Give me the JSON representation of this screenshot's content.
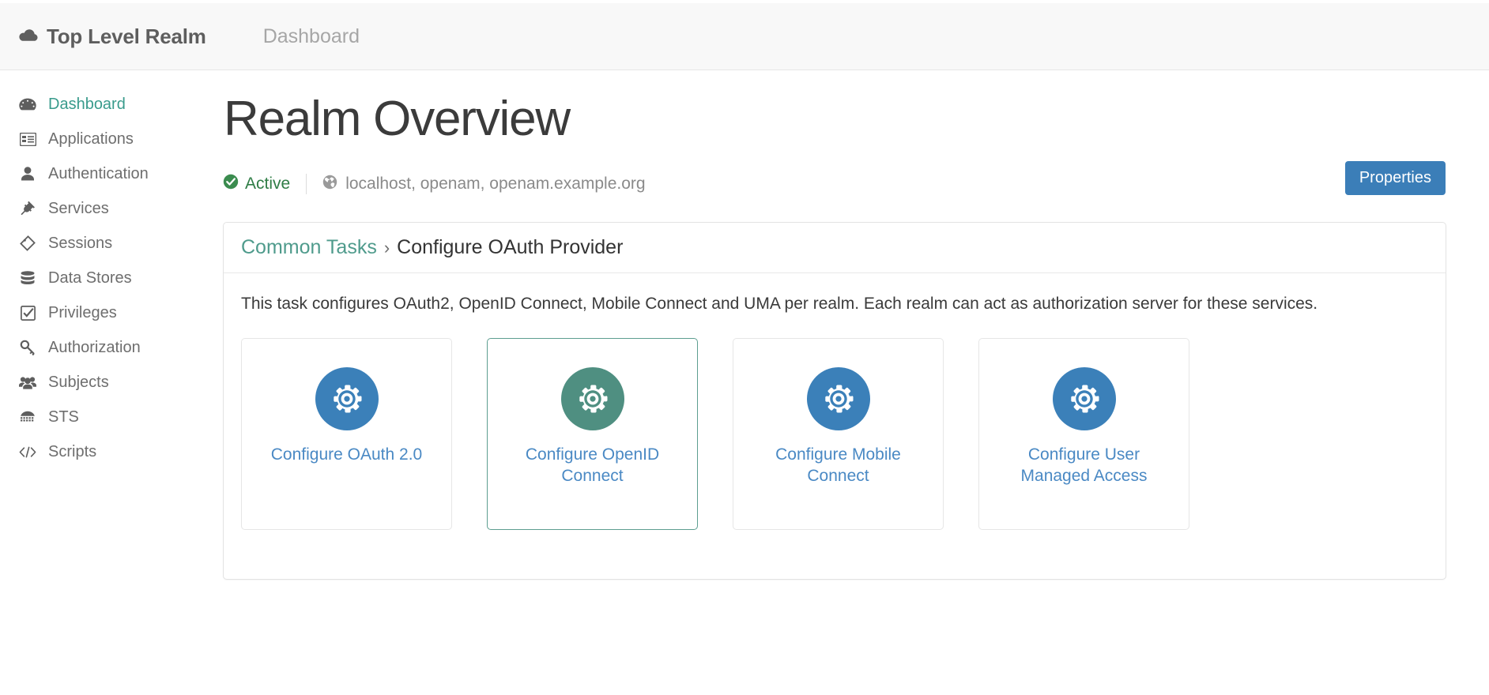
{
  "header": {
    "realm_icon": "cloud-icon",
    "realm_name": "Top Level Realm",
    "nav_item": "Dashboard"
  },
  "sidebar": {
    "items": [
      {
        "label": "Dashboard",
        "icon": "dashboard-gauge-icon",
        "active": true
      },
      {
        "label": "Applications",
        "icon": "applications-list-icon",
        "active": false
      },
      {
        "label": "Authentication",
        "icon": "user-icon",
        "active": false
      },
      {
        "label": "Services",
        "icon": "plug-icon",
        "active": false
      },
      {
        "label": "Sessions",
        "icon": "tag-icon",
        "active": false
      },
      {
        "label": "Data Stores",
        "icon": "database-icon",
        "active": false
      },
      {
        "label": "Privileges",
        "icon": "checked-box-icon",
        "active": false
      },
      {
        "label": "Authorization",
        "icon": "key-icon",
        "active": false
      },
      {
        "label": "Subjects",
        "icon": "users-group-icon",
        "active": false
      },
      {
        "label": "STS",
        "icon": "gavel-icon",
        "active": false
      },
      {
        "label": "Scripts",
        "icon": "code-brackets-icon",
        "active": false
      }
    ]
  },
  "main": {
    "title": "Realm Overview",
    "status": {
      "state_icon": "check-circle-icon",
      "state_label": "Active",
      "hosts_icon": "globe-icon",
      "hosts": "localhost, openam, openam.example.org"
    },
    "properties_button": "Properties",
    "panel": {
      "breadcrumb_link": "Common Tasks",
      "breadcrumb_separator": "›",
      "breadcrumb_current": "Configure OAuth Provider",
      "description": "This task configures OAuth2, OpenID Connect, Mobile Connect and UMA per realm. Each realm can act as authorization server for these services.",
      "cards": [
        {
          "label": "Configure OAuth 2.0",
          "icon": "gear-icon",
          "hovered": false
        },
        {
          "label": "Configure OpenID Connect",
          "icon": "gear-icon",
          "hovered": true
        },
        {
          "label": "Configure Mobile Connect",
          "icon": "gear-icon",
          "hovered": false
        },
        {
          "label": "Configure User Managed Access",
          "icon": "gear-icon",
          "hovered": false
        }
      ]
    }
  },
  "colors": {
    "accent_teal": "#399b8c",
    "link_blue": "#4a89c4",
    "button_blue": "#3b7eb8",
    "status_green": "#2f7d46",
    "icon_blue": "#3b80b9",
    "icon_teal": "#4f8f81"
  }
}
